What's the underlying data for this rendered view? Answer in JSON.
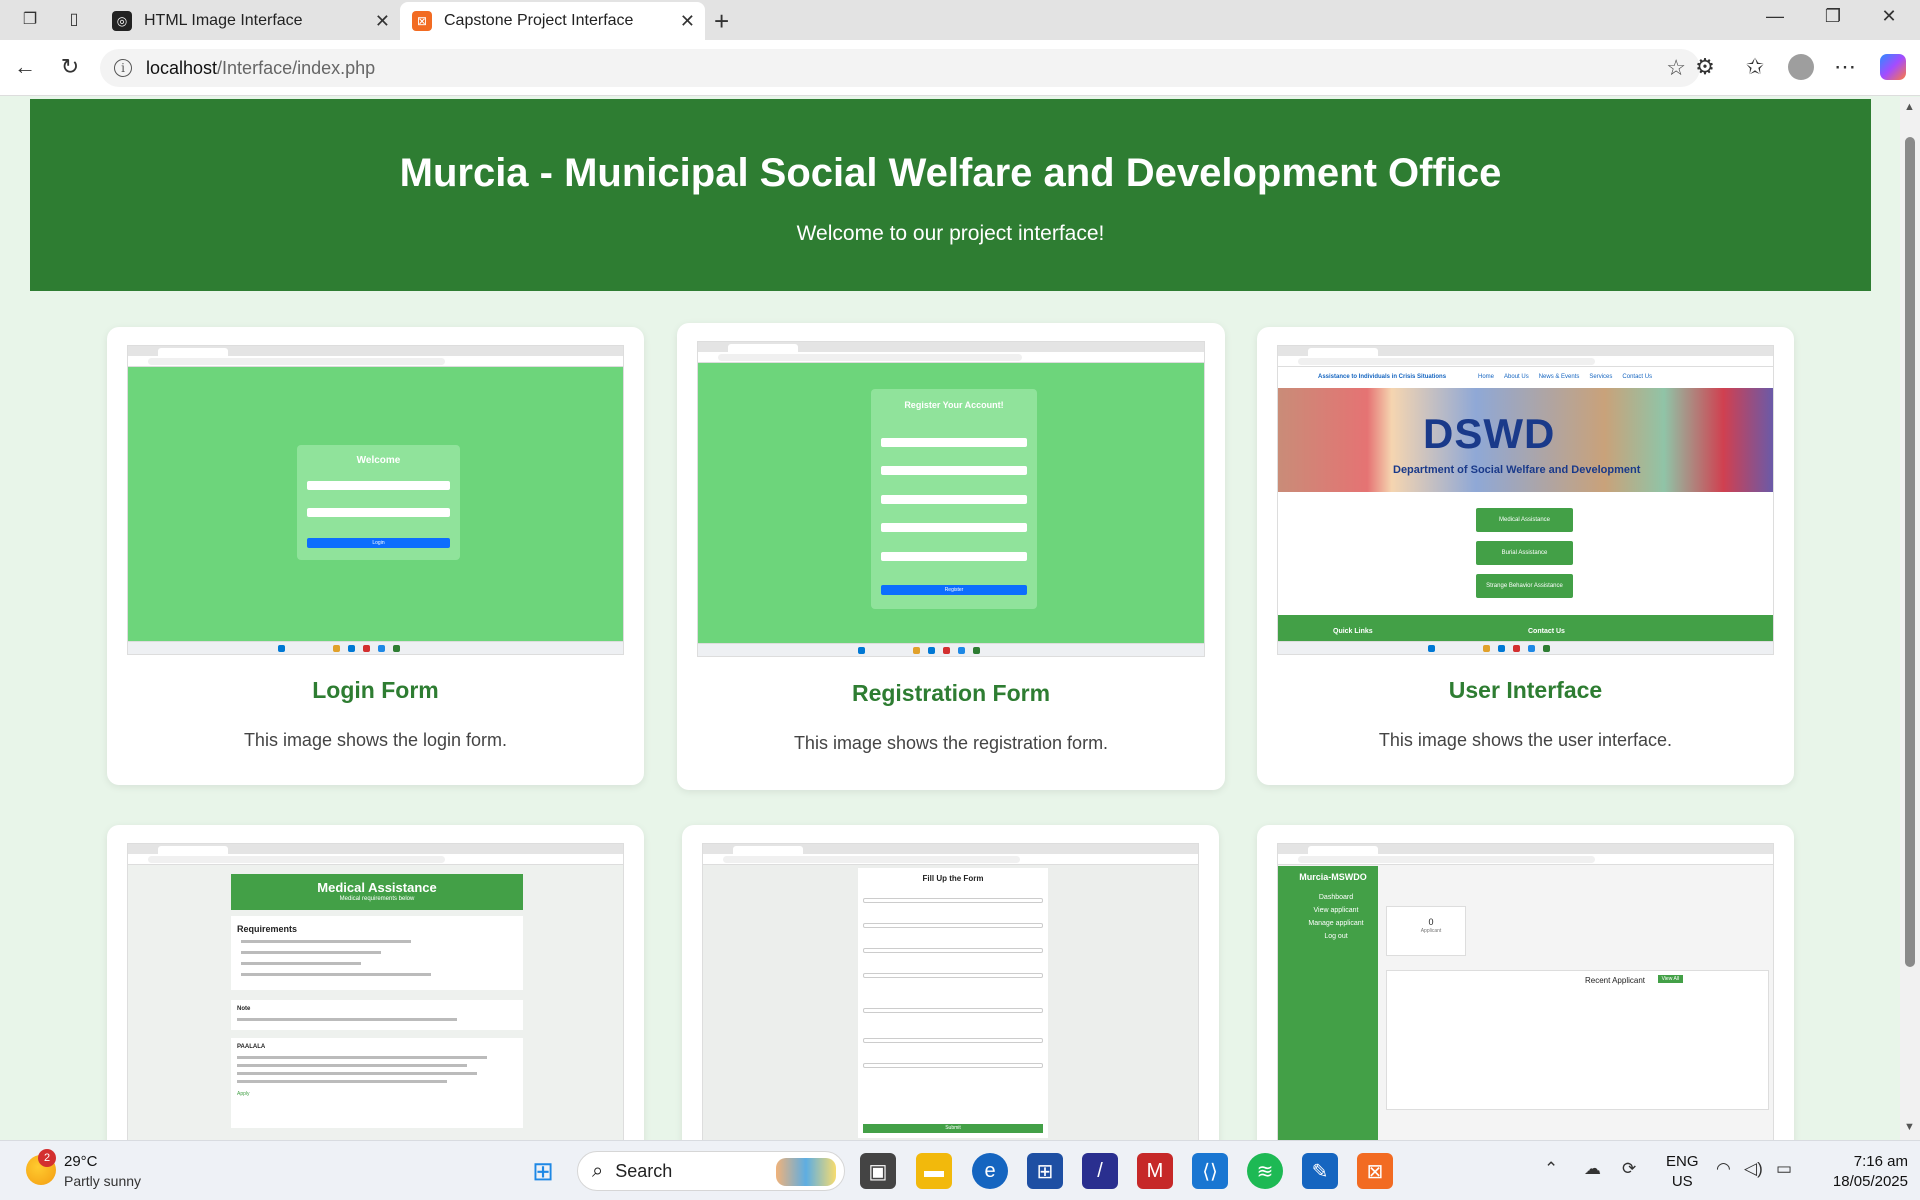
{
  "browser": {
    "tabs": [
      {
        "title": "HTML Image Interface",
        "active": false
      },
      {
        "title": "Capstone Project Interface",
        "active": true
      }
    ],
    "url_host": "localhost",
    "url_path": "/Interface/index.php"
  },
  "page": {
    "title": "Murcia - Municipal Social Welfare and Development Office",
    "subtitle": "Welcome to our project interface!"
  },
  "cards": [
    {
      "title": "Login Form",
      "description": "This image shows the login form."
    },
    {
      "title": "Registration Form",
      "description": "This image shows the registration form."
    },
    {
      "title": "User Interface",
      "description": "This image shows the user interface."
    }
  ],
  "screens": {
    "login": {
      "heading": "Welcome",
      "button": "Login"
    },
    "register": {
      "heading": "Register Your Account!",
      "button": "Register"
    },
    "user": {
      "site_title": "Assistance to Individuals in Crisis Situations",
      "nav": [
        "Home",
        "About Us",
        "News & Events",
        "Services",
        "Contact Us"
      ],
      "banner": "DSWD",
      "banner_sub": "Department of Social Welfare and Development",
      "buttons": [
        "Medical Assistance",
        "Burial Assistance",
        "Strange Behavior Assistance"
      ],
      "footer": [
        "Quick Links",
        "Contact Us"
      ]
    },
    "medical": {
      "heading": "Medical Assistance",
      "subheading": "Medical requirements below",
      "requirements_title": "Requirements",
      "note_title": "Note",
      "paalala_title": "PAALALA",
      "apply": "Apply"
    },
    "fillup": {
      "heading": "Fill Up the Form",
      "button": "Submit"
    },
    "admin": {
      "brand": "Murcia-MSWDO",
      "menu": [
        "Dashboard",
        "View applicant",
        "Manage applicant",
        "Log out"
      ],
      "count": "0",
      "count_label": "Applicant",
      "recent": "Recent Applicant",
      "view_all": "View All"
    }
  },
  "taskbar": {
    "temperature": "29°C",
    "weather": "Partly sunny",
    "weather_badge": "2",
    "search_placeholder": "Search",
    "lang_line1": "ENG",
    "lang_line2": "US",
    "time": "7:16 am",
    "date": "18/05/2025"
  },
  "colors": {
    "header_green": "#2e7d32",
    "page_bg": "#e8f5e9",
    "card_title": "#2e7d32",
    "screen_green": "#6dd57b"
  }
}
